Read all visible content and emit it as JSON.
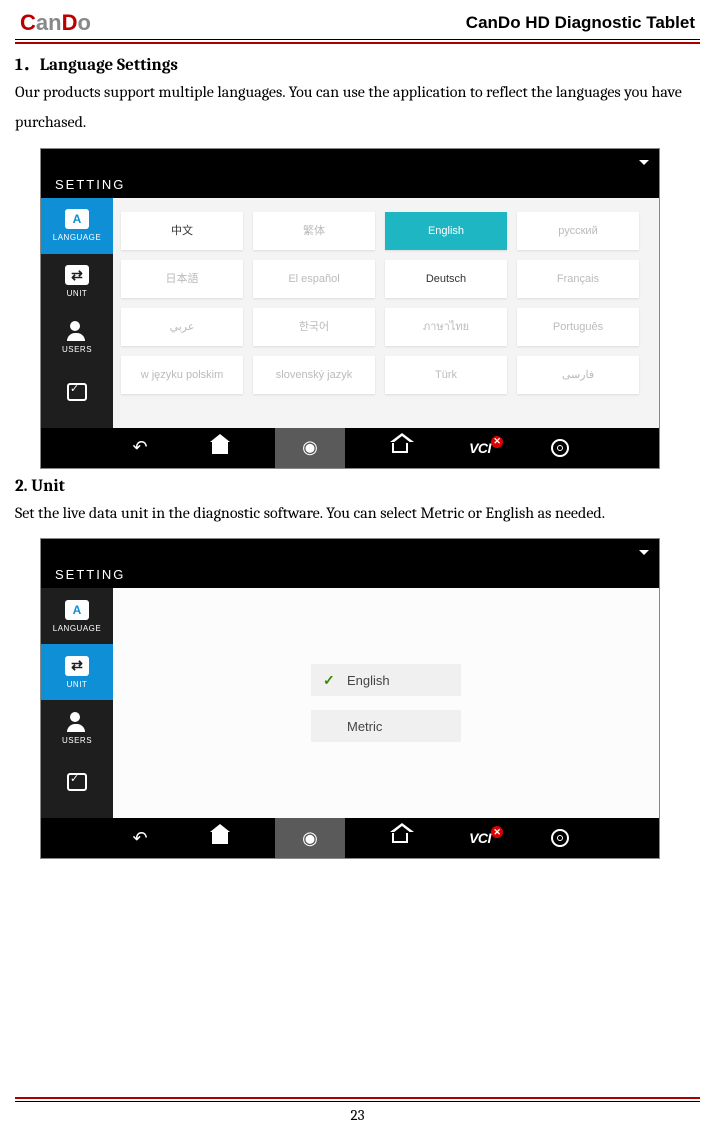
{
  "header": {
    "doc_title": "CanDo HD Diagnostic Tablet"
  },
  "section1": {
    "heading": "1．Language Settings",
    "text": "Our products support multiple languages. You can use the application to reflect the languages you have purchased."
  },
  "section2": {
    "heading": "2. Unit",
    "text": "Set the live data unit in the diagnostic software. You can select Metric or English as needed."
  },
  "screenshot_common": {
    "title": "SETTING",
    "sidebar": {
      "language": "LANGUAGE",
      "unit": "UNIT",
      "users": "USERS"
    },
    "bottombar": {
      "vci": "VCI"
    }
  },
  "languages": [
    {
      "label": "中文",
      "state": "avail"
    },
    {
      "label": "繁体",
      "state": "disabled"
    },
    {
      "label": "English",
      "state": "selected"
    },
    {
      "label": "русский",
      "state": "disabled"
    },
    {
      "label": "日本語",
      "state": "disabled"
    },
    {
      "label": "El español",
      "state": "disabled"
    },
    {
      "label": "Deutsch",
      "state": "avail"
    },
    {
      "label": "Français",
      "state": "disabled"
    },
    {
      "label": "عربي",
      "state": "disabled"
    },
    {
      "label": "한국어",
      "state": "disabled"
    },
    {
      "label": "ภาษาไทย",
      "state": "disabled"
    },
    {
      "label": "Português",
      "state": "disabled"
    },
    {
      "label": "w języku polskim",
      "state": "disabled"
    },
    {
      "label": "slovenský jazyk",
      "state": "disabled"
    },
    {
      "label": "Türk",
      "state": "disabled"
    },
    {
      "label": "فارسی",
      "state": "disabled"
    }
  ],
  "units": {
    "english": "English",
    "metric": "Metric"
  },
  "footer": {
    "page": "23"
  }
}
